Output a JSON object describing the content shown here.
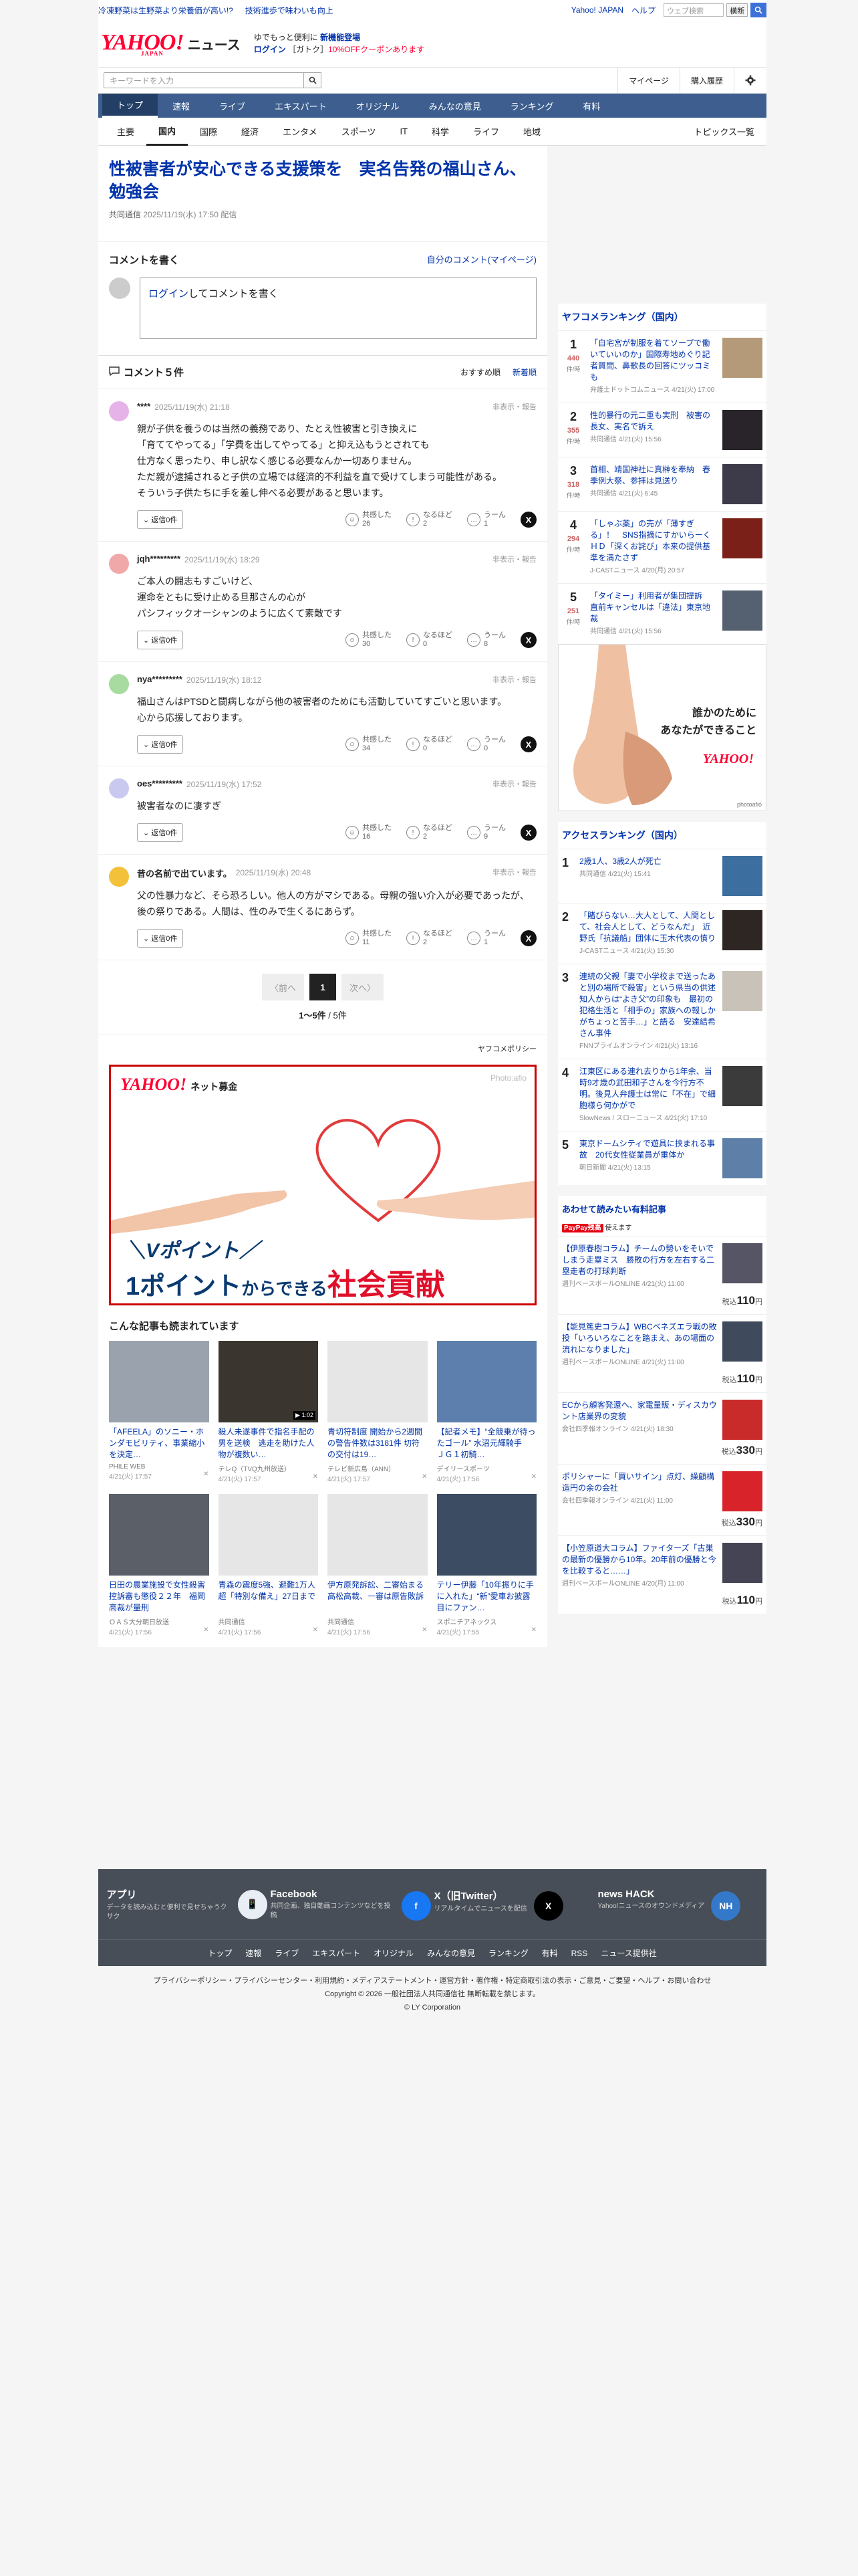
{
  "topbar": {
    "link1": "冷凍野菜は生野菜より栄養価が高い!?",
    "link2": "技術進歩で味わいも向上",
    "yj": "Yahoo! JAPAN",
    "help": "ヘルプ",
    "search_placeholder": "ウェブ検索",
    "search_btn": "横断"
  },
  "brand": {
    "logo": "YAHOO!",
    "logo_sub": "JAPAN",
    "news": "ニュース",
    "promo1a": "ゆでもっと便利に",
    "promo1b": "新機能登場",
    "promo2a": "ログイン",
    "promo2b": "［ガトク］",
    "promo2c": "10%OFFクーポンあります"
  },
  "search": {
    "placeholder": "キーワードを入力",
    "mypage": "マイページ",
    "history": "購入履歴"
  },
  "gnav": [
    "トップ",
    "速報",
    "ライブ",
    "エキスパート",
    "オリジナル",
    "みんなの意見",
    "ランキング",
    "有料"
  ],
  "snav": [
    "主要",
    "国内",
    "国際",
    "経済",
    "エンタメ",
    "スポーツ",
    "IT",
    "科学",
    "ライフ",
    "地域"
  ],
  "snav_right": "トピックス一覧",
  "article": {
    "title": "性被害者が安心できる支援策を　実名告発の福山さん、勉強会",
    "source": "共同通信",
    "date": "2025/11/19(水) 17:50 配信"
  },
  "comment_write": {
    "heading": "コメントを書く",
    "mine": "自分のコメント(マイページ)",
    "login": "ログイン",
    "prompt": "してコメントを書く"
  },
  "comments_header": {
    "title": "コメント５件",
    "sort1": "おすすめ順",
    "sort2": "新着順"
  },
  "comment_labels": {
    "report": "非表示・報告",
    "reply": "返信0件",
    "empathy": "共感した",
    "think": "なるほど",
    "hmm": "うーん"
  },
  "comments": [
    {
      "name": "****",
      "date": "2025/11/19(水) 21:18",
      "text": "親が子供を養うのは当然の義務であり、たとえ性被害と引き換えに\n「育ててやってる」「学費を出してやってる」と抑え込もうとされても\n仕方なく思ったり、申し訳なく感じる必要なんか一切ありません。\nただ親が逮捕されると子供の立場では経済的不利益を直で受けてしまう可能性がある。\nそういう子供たちに手を差し伸べる必要があると思います。",
      "e": "26",
      "t": "2",
      "h": "1",
      "color": "#e6b3e8"
    },
    {
      "name": "jqh*********",
      "date": "2025/11/19(水) 18:29",
      "text": "ご本人の闘志もすごいけど、\n運命をともに受け止める旦那さんの心が\nパシフィックオーシャンのように広くて素敵です",
      "e": "30",
      "t": "0",
      "h": "8",
      "color": "#f0a8a8"
    },
    {
      "name": "nya*********",
      "date": "2025/11/19(水) 18:12",
      "text": "福山さんはPTSDと闘病しながら他の被害者のためにも活動していてすごいと思います。\n心から応援しております。",
      "e": "34",
      "t": "0",
      "h": "0",
      "color": "#a8dba0"
    },
    {
      "name": "oes*********",
      "date": "2025/11/19(水) 17:52",
      "text": "被害者なのに凄すぎ",
      "e": "16",
      "t": "2",
      "h": "9",
      "color": "#c9c9f0"
    },
    {
      "name": "昔の名前で出ています。",
      "date": "2025/11/19(水) 20:48",
      "text": "父の性暴力など、そら恐ろしい。他人の方がマシである。母親の強い介入が必要であったが、後の祭りである。人間は、性のみで生くるにあらず。",
      "e": "11",
      "t": "2",
      "h": "1",
      "color": "#f3c23a"
    }
  ],
  "pager": {
    "prev": "〈前へ",
    "cur": "1",
    "next": "次へ〉",
    "count": "1〜5件",
    "total": " / 5件"
  },
  "policy": "ヤフコメポリシー",
  "bigad": {
    "yj": "YAHOO!",
    "name": "ネット募金",
    "credit": "Photo:afio",
    "line1": "＼Vポイント／",
    "line2a": "1ポイント",
    "line2b": "からできる",
    "line2c": "社会貢献"
  },
  "related": {
    "heading": "こんな記事も読まれています",
    "items": [
      {
        "title": "「AFEELA」のソニー・ホンダモビリティ、事業縮小を決定…",
        "src": "PHILE WEB",
        "dt": "4/21(火) 17:57",
        "bg": "#9aa3ad"
      },
      {
        "title": "殺人未遂事件で指名手配の男を送検　逃走を助けた人物が複数い…",
        "src": "テレQ（TVQ九州放送）",
        "dt": "4/21(火) 17:57",
        "bg": "#3a352e",
        "badge": "▶ 1:02"
      },
      {
        "title": "青切符制度 開始から2週間の警告件数は3181件 切符の交付は19…",
        "src": "テレビ新広島（ANN）",
        "dt": "4/21(火) 17:57",
        "bg": "#e6e6e6"
      },
      {
        "title": "【記者メモ】“全競乗が待ったゴール” 水沼元輝騎手　ＪＧ１初騎…",
        "src": "デイリースポーツ",
        "dt": "4/21(火) 17:56",
        "bg": "#5c7fae"
      },
      {
        "title": "日田の農業施設で女性殺害　控訴審も懲役２２年　福岡高裁が量刑",
        "src": "ＯＡＳ大分朝日放送",
        "dt": "4/21(火) 17:56",
        "bg": "#5a5f68"
      },
      {
        "title": "青森の震度5強、避難1万人超「特別な備え」27日まで",
        "src": "共同通信",
        "dt": "4/21(火) 17:56",
        "bg": "#e6e6e6"
      },
      {
        "title": "伊方原発訴訟、二審始まる　高松高裁、一審は原告敗訴",
        "src": "共同通信",
        "dt": "4/21(火) 17:56",
        "bg": "#e6e6e6"
      },
      {
        "title": "テリー伊藤「10年振りに手に入れた」“新”愛車お披露目にファン…",
        "src": "スポニチアネックス",
        "dt": "4/21(火) 17:55",
        "bg": "#3b4c63"
      }
    ]
  },
  "sidebar": {
    "ranking_title": "ヤフコメランキング（国内）",
    "unit": "件/時",
    "ranking": [
      {
        "n": "1",
        "c": "440",
        "title": "「自宅宮が制服を着てソープで働いていいのか」国際寿地めぐり記者質問、鼻歌長の回答にツッコミも",
        "src": "弁護士ドットコムニュース 4/21(火) 17:00",
        "bg": "#b59a7a"
      },
      {
        "n": "2",
        "c": "355",
        "title": "性的暴行の元二重も実刑　被害の長女、実名で訴え",
        "src": "共同通信 4/21(火) 15:56",
        "bg": "#28242a"
      },
      {
        "n": "3",
        "c": "318",
        "title": "首相、靖国神社に真榊を奉納　春季例大祭、参拝は見送り",
        "src": "共同通信 4/21(火) 6:45",
        "bg": "#3d3a4a"
      },
      {
        "n": "4",
        "c": "294",
        "title": "「しゃぶ薬」の売が「薄すぎる」！　SNS指摘にすかいらーくＨＤ「深くお詫び」本来の提供基準を満たさず",
        "src": "J-CASTニュース 4/20(月) 20:57",
        "bg": "#7a2018"
      },
      {
        "n": "5",
        "c": "251",
        "title": "「タイミー」利用者が集団提訴　直前キャンセルは「違法」東京地裁",
        "src": "共同通信 4/21(火) 15:56",
        "bg": "#556070"
      }
    ],
    "sad_q1": "誰かのために",
    "sad_q2": "あなたができること",
    "sad_yj": "YAHOO!",
    "sad_credit": "photoafio",
    "access_title": "アクセスランキング（国内）",
    "access": [
      {
        "n": "1",
        "title": "2歳1人、3歳2人が死亡",
        "src": "共同通信 4/21(火) 15:41",
        "bg": "#3c6fa0"
      },
      {
        "n": "2",
        "title": "「賭びらない…大人として、人間として、社会人として、どうなんだ」　近野氏「抗議船」団体に玉木代表の憤り",
        "src": "J-CASTニュース 4/21(火) 15:30",
        "bg": "#2e2622"
      },
      {
        "n": "3",
        "title": "連続の父親「妻で小学校まで送ったあと別の場所で殺害」という県当の供述　知人からは“よき父”の印象も　最初の犯格生活と「相手の」家族への報しかがちょっと苦手…」と語る　安達結希さん事件",
        "src": "FNNプライムオンライン 4/21(火) 13:16",
        "bg": "#c9c2b9"
      },
      {
        "n": "4",
        "title": "江東区にある連れ去りから1年余、当時9才歳の武田和子さんを今行方不明。後見人弁護士は常に「不在」で細胞様ら何かがで",
        "src": "SlowNews / スローニュース 4/21(火) 17:10",
        "bg": "#3b3b3b"
      },
      {
        "n": "5",
        "title": "東京ドームシティで遊具に挟まれる事故　20代女性従業員が重体か",
        "src": "朝日新聞 4/21(火) 13:15",
        "bg": "#5d7fa8"
      }
    ],
    "paid_title": "あわせて読みたい有料記事",
    "paid_badge": "PayPay残高",
    "paid_badge2": "使えます",
    "yen_label": "税込",
    "paid": [
      {
        "title": "【伊原春樹コラム】チームの勢いをそいでしまう走塁ミス　勝敗の行方を左右する二塁走者の打球判断",
        "src": "週刊ベースボールONLINE 4/21(火) 11:00",
        "price": "110",
        "unit": "円",
        "bg": "#556"
      },
      {
        "title": "【能見篤史コラム】WBCベネズエラ戦の敗投「いろいろなことを踏まえ、あの場面の流れになりました」",
        "src": "週刊ベースボールONLINE 4/21(火) 11:00",
        "price": "110",
        "unit": "円",
        "bg": "#3f4a5c"
      },
      {
        "title": "ECから顧客発還へ、家電量販・ディスカウント店業界の変貌",
        "src": "会社四季報オンライン 4/21(火) 18:30",
        "price": "330",
        "unit": "円",
        "bg": "#c92a2a"
      },
      {
        "title": "ポリシャーに「買いサイン」点灯、繰顧構造円の余の会社",
        "src": "会社四季報オンライン 4/21(火) 11:00",
        "price": "330",
        "unit": "円",
        "bg": "#d8232a"
      },
      {
        "title": "【小笠原道大コラム】ファイターズ「古巣の最新の優勝から10年。20年前の優勝と今を比較すると……」",
        "src": "週刊ベースボールONLINE 4/20(月) 11:00",
        "price": "110",
        "unit": "円",
        "bg": "#445"
      }
    ]
  },
  "footer": {
    "apps": [
      {
        "t": "アプリ",
        "d": "データを読み込むと便利で見せちゃうクサク",
        "ic": "📱",
        "bg": "#e9eef5"
      },
      {
        "t": "Facebook",
        "d": "共同企画、独自動画コンテンツなどを投稿",
        "ic": "f",
        "bg": "#1877f2"
      },
      {
        "t": "X（旧Twitter）",
        "d": "リアルタイムでニュースを配信",
        "ic": "X",
        "bg": "#000"
      },
      {
        "t": "news HACK",
        "d": "Yahoo!ニュースのオウンドメディア",
        "ic": "NH",
        "bg": "#3478c9"
      }
    ],
    "nav": [
      "トップ",
      "速報",
      "ライブ",
      "エキスパート",
      "オリジナル",
      "みんなの意見",
      "ランキング",
      "有料",
      "RSS",
      "ニュース提供社"
    ],
    "links": "プライバシーポリシー・プライバシーセンター・利用規約・メディアステートメント・運営方針・著作権・特定商取引法の表示・ご意見・ご要望・ヘルプ・お問い合わせ",
    "copy1": "Copyright © 2026 一般社団法人共同通信社 無断転載を禁じます。",
    "copy2": "© LY Corporation"
  }
}
